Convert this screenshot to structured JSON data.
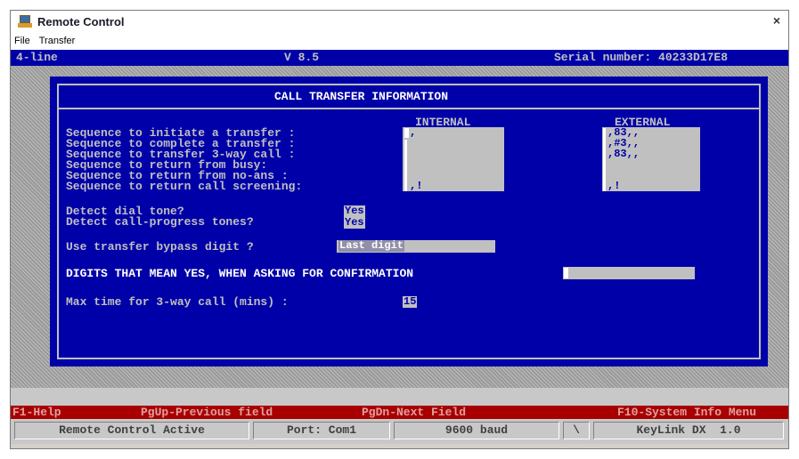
{
  "window": {
    "title": "Remote Control",
    "close_glyph": "×",
    "menu": [
      "File",
      "Transfer"
    ]
  },
  "status": {
    "mode": "4-line",
    "version": "V 8.5",
    "serial": "Serial number: 40233D17E8"
  },
  "panel": {
    "title": "CALL TRANSFER INFORMATION",
    "col_internal": "INTERNAL",
    "col_external": "EXTERNAL",
    "rows": [
      {
        "label": "Sequence to initiate a transfer :",
        "internal": ",",
        "external": ",83,,"
      },
      {
        "label": "Sequence to complete a transfer :",
        "internal": "",
        "external": ",#3,,"
      },
      {
        "label": "Sequence to transfer 3-way call :",
        "internal": "",
        "external": ",83,,"
      },
      {
        "label": "Sequence to return from busy:",
        "internal": "",
        "external": ""
      },
      {
        "label": "Sequence to return from no-ans :",
        "internal": "",
        "external": ""
      },
      {
        "label": "Sequence to return call screening:",
        "internal": ",!",
        "external": ",!"
      }
    ],
    "detect_dial_label": "Detect dial tone?",
    "detect_dial_value": "Yes",
    "detect_progress_label": "Detect call-progress tones?",
    "detect_progress_value": "Yes",
    "bypass_label": "Use transfer bypass digit ?",
    "bypass_value": "Last digit",
    "confirm_label": "DIGITS THAT MEAN YES, WHEN ASKING FOR CONFIRMATION",
    "confirm_value": "",
    "maxtime_label": "Max time for 3-way call (mins) :",
    "maxtime_value": "15"
  },
  "fkeys": {
    "f1": "F1-Help",
    "pgup": "PgUp-Previous field",
    "pgdn": "PgDn-Next Field",
    "f10": "F10-System Info Menu"
  },
  "bottom": {
    "remote": "Remote Control Active",
    "port": "Port: Com1",
    "baud": "9600 baud",
    "spinner": "\\",
    "product": "KeyLink DX  1.0"
  },
  "colors": {
    "dos_blue": "#0000a8",
    "field_grey": "#c0c0c0",
    "fkey_red": "#a80000"
  }
}
